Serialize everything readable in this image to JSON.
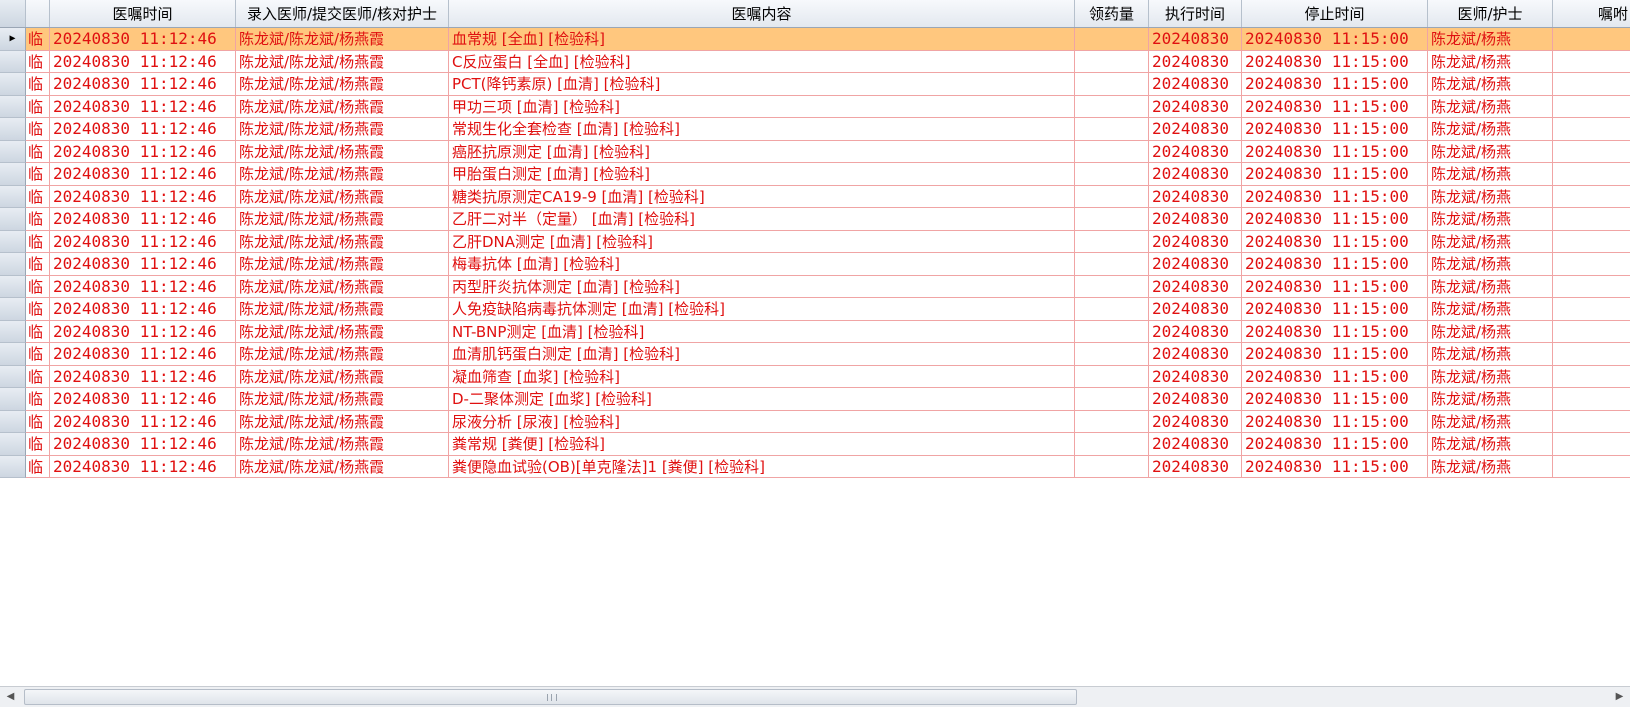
{
  "columns": {
    "type": "",
    "order_time": "医嘱时间",
    "doctors": "录入医师/提交医师/核对护士",
    "content": "医嘱内容",
    "quantity": "领药量",
    "exec_time": "执行时间",
    "stop_time": "停止时间",
    "doctor_nurse": "医师/护士",
    "note": "嘱咐"
  },
  "rows": [
    {
      "type": "临",
      "order_time": "20240830 11:12:46",
      "doctors": "陈龙斌/陈龙斌/杨燕霞",
      "content": "血常规 [全血]  [检验科]",
      "quantity": "",
      "exec_time": "20240830",
      "stop_time": "20240830 11:15:00",
      "doctor_nurse": "陈龙斌/杨燕",
      "note": ""
    },
    {
      "type": "临",
      "order_time": "20240830 11:12:46",
      "doctors": "陈龙斌/陈龙斌/杨燕霞",
      "content": "C反应蛋白 [全血]  [检验科]",
      "quantity": "",
      "exec_time": "20240830",
      "stop_time": "20240830 11:15:00",
      "doctor_nurse": "陈龙斌/杨燕",
      "note": ""
    },
    {
      "type": "临",
      "order_time": "20240830 11:12:46",
      "doctors": "陈龙斌/陈龙斌/杨燕霞",
      "content": "PCT(降钙素原) [血清]  [检验科]",
      "quantity": "",
      "exec_time": "20240830",
      "stop_time": "20240830 11:15:00",
      "doctor_nurse": "陈龙斌/杨燕",
      "note": ""
    },
    {
      "type": "临",
      "order_time": "20240830 11:12:46",
      "doctors": "陈龙斌/陈龙斌/杨燕霞",
      "content": "甲功三项 [血清]  [检验科]",
      "quantity": "",
      "exec_time": "20240830",
      "stop_time": "20240830 11:15:00",
      "doctor_nurse": "陈龙斌/杨燕",
      "note": ""
    },
    {
      "type": "临",
      "order_time": "20240830 11:12:46",
      "doctors": "陈龙斌/陈龙斌/杨燕霞",
      "content": "常规生化全套检查 [血清]  [检验科]",
      "quantity": "",
      "exec_time": "20240830",
      "stop_time": "20240830 11:15:00",
      "doctor_nurse": "陈龙斌/杨燕",
      "note": ""
    },
    {
      "type": "临",
      "order_time": "20240830 11:12:46",
      "doctors": "陈龙斌/陈龙斌/杨燕霞",
      "content": "癌胚抗原测定 [血清]  [检验科]",
      "quantity": "",
      "exec_time": "20240830",
      "stop_time": "20240830 11:15:00",
      "doctor_nurse": "陈龙斌/杨燕",
      "note": ""
    },
    {
      "type": "临",
      "order_time": "20240830 11:12:46",
      "doctors": "陈龙斌/陈龙斌/杨燕霞",
      "content": "甲胎蛋白测定 [血清]  [检验科]",
      "quantity": "",
      "exec_time": "20240830",
      "stop_time": "20240830 11:15:00",
      "doctor_nurse": "陈龙斌/杨燕",
      "note": ""
    },
    {
      "type": "临",
      "order_time": "20240830 11:12:46",
      "doctors": "陈龙斌/陈龙斌/杨燕霞",
      "content": "糖类抗原测定CA19-9 [血清]  [检验科]",
      "quantity": "",
      "exec_time": "20240830",
      "stop_time": "20240830 11:15:00",
      "doctor_nurse": "陈龙斌/杨燕",
      "note": ""
    },
    {
      "type": "临",
      "order_time": "20240830 11:12:46",
      "doctors": "陈龙斌/陈龙斌/杨燕霞",
      "content": "乙肝二对半（定量） [血清]  [检验科]",
      "quantity": "",
      "exec_time": "20240830",
      "stop_time": "20240830 11:15:00",
      "doctor_nurse": "陈龙斌/杨燕",
      "note": ""
    },
    {
      "type": "临",
      "order_time": "20240830 11:12:46",
      "doctors": "陈龙斌/陈龙斌/杨燕霞",
      "content": "乙肝DNA测定 [血清]  [检验科]",
      "quantity": "",
      "exec_time": "20240830",
      "stop_time": "20240830 11:15:00",
      "doctor_nurse": "陈龙斌/杨燕",
      "note": ""
    },
    {
      "type": "临",
      "order_time": "20240830 11:12:46",
      "doctors": "陈龙斌/陈龙斌/杨燕霞",
      "content": "梅毒抗体 [血清]  [检验科]",
      "quantity": "",
      "exec_time": "20240830",
      "stop_time": "20240830 11:15:00",
      "doctor_nurse": "陈龙斌/杨燕",
      "note": ""
    },
    {
      "type": "临",
      "order_time": "20240830 11:12:46",
      "doctors": "陈龙斌/陈龙斌/杨燕霞",
      "content": "丙型肝炎抗体测定 [血清]  [检验科]",
      "quantity": "",
      "exec_time": "20240830",
      "stop_time": "20240830 11:15:00",
      "doctor_nurse": "陈龙斌/杨燕",
      "note": ""
    },
    {
      "type": "临",
      "order_time": "20240830 11:12:46",
      "doctors": "陈龙斌/陈龙斌/杨燕霞",
      "content": "人免疫缺陷病毒抗体测定 [血清]  [检验科]",
      "quantity": "",
      "exec_time": "20240830",
      "stop_time": "20240830 11:15:00",
      "doctor_nurse": "陈龙斌/杨燕",
      "note": ""
    },
    {
      "type": "临",
      "order_time": "20240830 11:12:46",
      "doctors": "陈龙斌/陈龙斌/杨燕霞",
      "content": "NT-BNP测定 [血清]  [检验科]",
      "quantity": "",
      "exec_time": "20240830",
      "stop_time": "20240830 11:15:00",
      "doctor_nurse": "陈龙斌/杨燕",
      "note": ""
    },
    {
      "type": "临",
      "order_time": "20240830 11:12:46",
      "doctors": "陈龙斌/陈龙斌/杨燕霞",
      "content": "血清肌钙蛋白测定 [血清]  [检验科]",
      "quantity": "",
      "exec_time": "20240830",
      "stop_time": "20240830 11:15:00",
      "doctor_nurse": "陈龙斌/杨燕",
      "note": ""
    },
    {
      "type": "临",
      "order_time": "20240830 11:12:46",
      "doctors": "陈龙斌/陈龙斌/杨燕霞",
      "content": "凝血筛查 [血浆]  [检验科]",
      "quantity": "",
      "exec_time": "20240830",
      "stop_time": "20240830 11:15:00",
      "doctor_nurse": "陈龙斌/杨燕",
      "note": ""
    },
    {
      "type": "临",
      "order_time": "20240830 11:12:46",
      "doctors": "陈龙斌/陈龙斌/杨燕霞",
      "content": "D-二聚体测定 [血浆]  [检验科]",
      "quantity": "",
      "exec_time": "20240830",
      "stop_time": "20240830 11:15:00",
      "doctor_nurse": "陈龙斌/杨燕",
      "note": ""
    },
    {
      "type": "临",
      "order_time": "20240830 11:12:46",
      "doctors": "陈龙斌/陈龙斌/杨燕霞",
      "content": "尿液分析 [尿液]  [检验科]",
      "quantity": "",
      "exec_time": "20240830",
      "stop_time": "20240830 11:15:00",
      "doctor_nurse": "陈龙斌/杨燕",
      "note": ""
    },
    {
      "type": "临",
      "order_time": "20240830 11:12:46",
      "doctors": "陈龙斌/陈龙斌/杨燕霞",
      "content": "粪常规 [粪便]  [检验科]",
      "quantity": "",
      "exec_time": "20240830",
      "stop_time": "20240830 11:15:00",
      "doctor_nurse": "陈龙斌/杨燕",
      "note": ""
    },
    {
      "type": "临",
      "order_time": "20240830 11:12:46",
      "doctors": "陈龙斌/陈龙斌/杨燕霞",
      "content": "粪便隐血试验(OB)[单克隆法]1 [粪便]  [检验科]",
      "quantity": "",
      "exec_time": "20240830",
      "stop_time": "20240830 11:15:00",
      "doctor_nurse": "陈龙斌/杨燕",
      "note": ""
    }
  ],
  "selected_row": 0,
  "icons": {
    "row_indicator": "triangle-right-icon",
    "scroll_left": "arrow-left-icon",
    "scroll_right": "arrow-right-icon"
  },
  "colors": {
    "text": "#e01010",
    "grid_line": "#f0a4a4",
    "selection": "#ffc77e"
  }
}
